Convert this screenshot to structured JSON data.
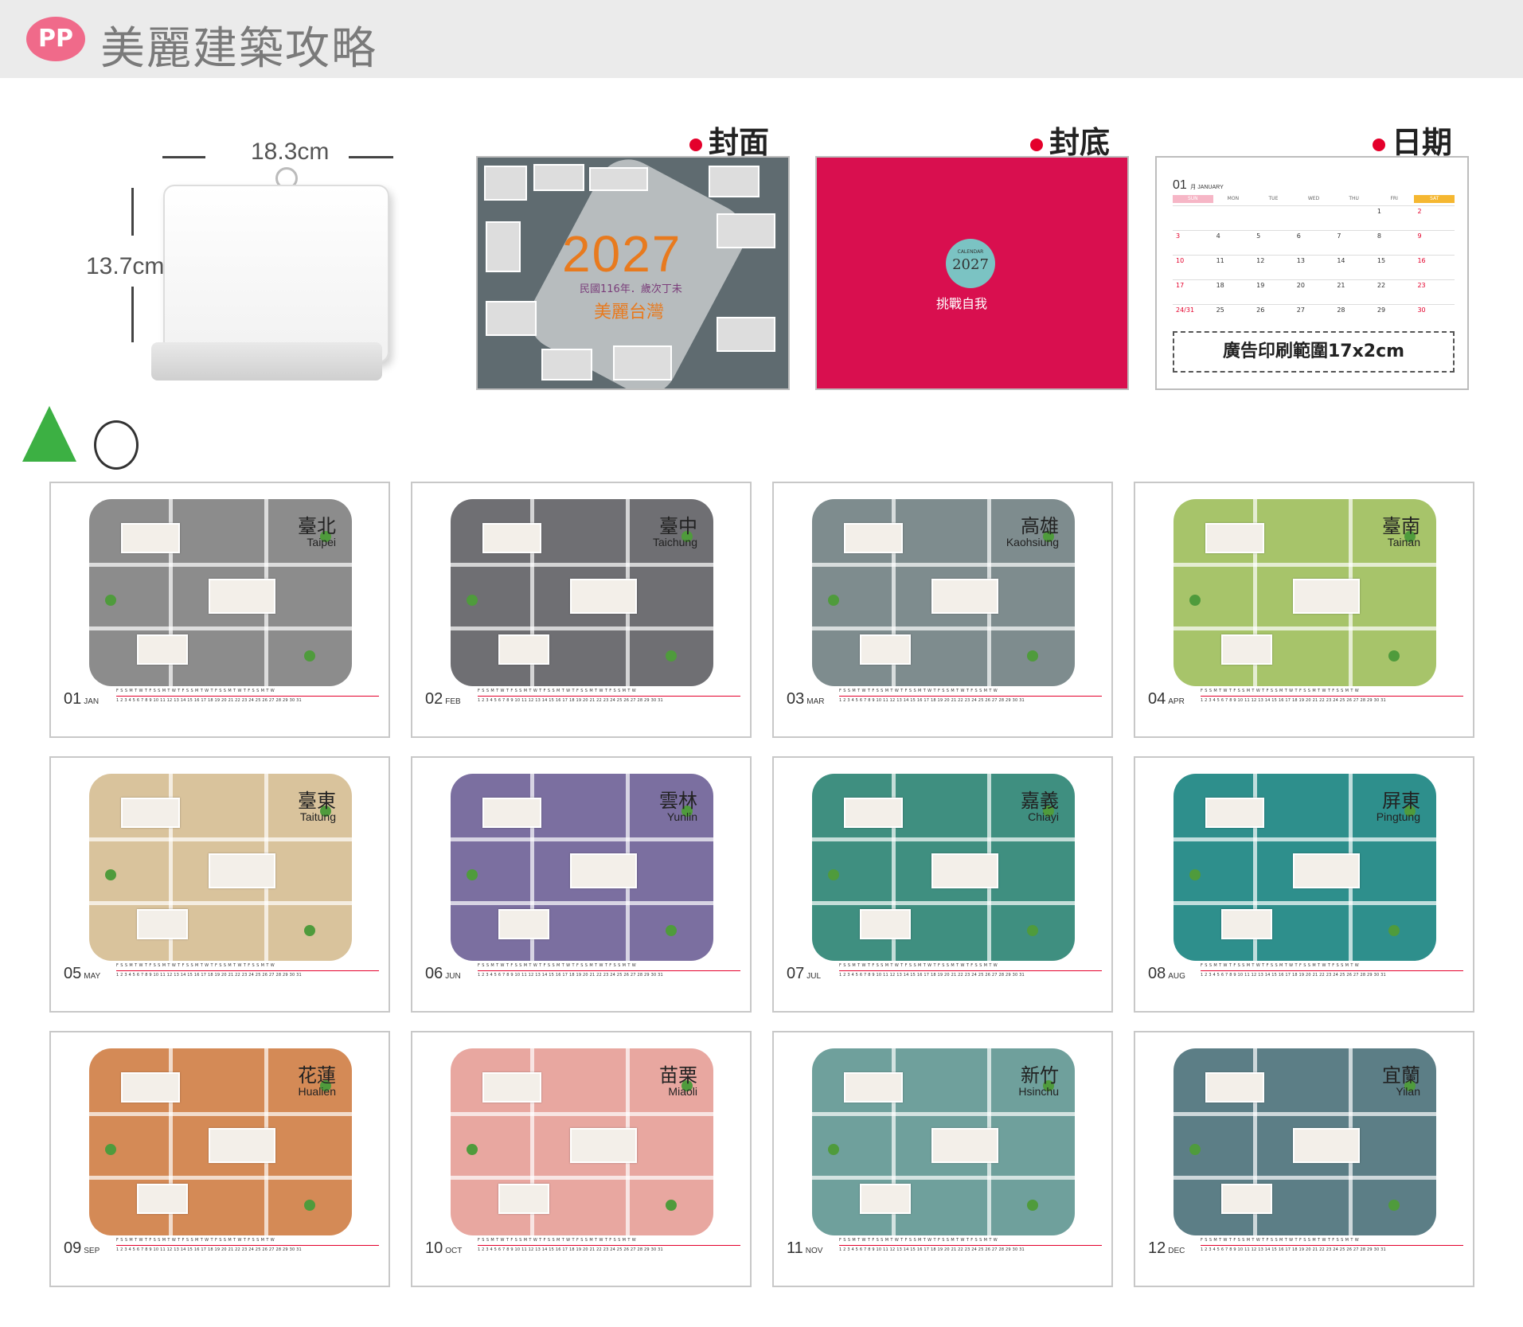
{
  "header": {
    "logo": "PP",
    "title": "美麗建築攻略"
  },
  "dimensions": {
    "width": "18.3cm",
    "height": "13.7cm"
  },
  "sections": {
    "cover_label": "封面",
    "back_label": "封底",
    "date_label": "日期"
  },
  "cover": {
    "year": "2027",
    "subtitle": "民國116年．歲次丁未",
    "name": "美麗台灣"
  },
  "back": {
    "calendar_small": "CALENDAR",
    "year": "2027",
    "slogan": "挑戰自我"
  },
  "date_panel": {
    "month": "01",
    "month_name": "月 JANUARY",
    "weekdays": [
      "SUN",
      "MON",
      "TUE",
      "WED",
      "THU",
      "FRI",
      "SAT"
    ],
    "weeks": [
      [
        "",
        "",
        "",
        "",
        "",
        "1",
        "2"
      ],
      [
        "3",
        "4",
        "5",
        "6",
        "7",
        "8",
        "9"
      ],
      [
        "10",
        "11",
        "12",
        "13",
        "14",
        "15",
        "16"
      ],
      [
        "17",
        "18",
        "19",
        "20",
        "21",
        "22",
        "23"
      ],
      [
        "24/31",
        "25",
        "26",
        "27",
        "28",
        "29",
        "30"
      ]
    ],
    "ad_area": "廣告印刷範圍17x2cm"
  },
  "months": [
    {
      "num": "01",
      "abbr": "JAN",
      "city_zh": "臺北",
      "city_en": "Taipei",
      "color": "#8c8c8c"
    },
    {
      "num": "02",
      "abbr": "FEB",
      "city_zh": "臺中",
      "city_en": "Taichung",
      "color": "#6f6f73"
    },
    {
      "num": "03",
      "abbr": "MAR",
      "city_zh": "高雄",
      "city_en": "Kaohsiung",
      "color": "#7e8c8e"
    },
    {
      "num": "04",
      "abbr": "APR",
      "city_zh": "臺南",
      "city_en": "Tainan",
      "color": "#a7c46a"
    },
    {
      "num": "05",
      "abbr": "MAY",
      "city_zh": "臺東",
      "city_en": "Taitung",
      "color": "#d9c39c"
    },
    {
      "num": "06",
      "abbr": "JUN",
      "city_zh": "雲林",
      "city_en": "Yunlin",
      "color": "#7b6fa0"
    },
    {
      "num": "07",
      "abbr": "JUL",
      "city_zh": "嘉義",
      "city_en": "Chiayi",
      "color": "#3f8f80"
    },
    {
      "num": "08",
      "abbr": "AUG",
      "city_zh": "屏東",
      "city_en": "Pingtung",
      "color": "#2e8f8c"
    },
    {
      "num": "09",
      "abbr": "SEP",
      "city_zh": "花蓮",
      "city_en": "Hualien",
      "color": "#d48a56"
    },
    {
      "num": "10",
      "abbr": "OCT",
      "city_zh": "苗栗",
      "city_en": "Miaoli",
      "color": "#e8a7a0"
    },
    {
      "num": "11",
      "abbr": "NOV",
      "city_zh": "新竹",
      "city_en": "Hsinchu",
      "color": "#6fa09c"
    },
    {
      "num": "12",
      "abbr": "DEC",
      "city_zh": "宜蘭",
      "city_en": "Yilan",
      "color": "#5c7e86"
    }
  ]
}
